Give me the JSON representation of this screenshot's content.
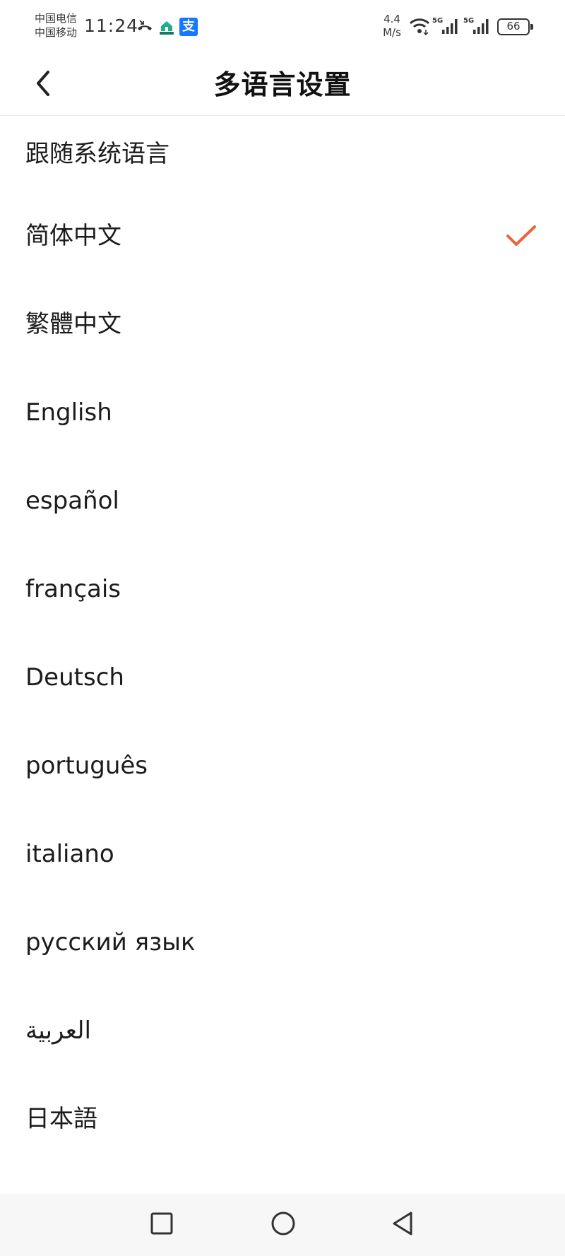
{
  "status_bar": {
    "carrier_1": "中国电信",
    "carrier_2": "中国移动",
    "time": "11:24",
    "net_speed_value": "4.4",
    "net_speed_unit": "M/s",
    "signal_1_label": "5G",
    "signal_2_label": "5G",
    "battery": "66",
    "alipay_glyph": "支"
  },
  "header": {
    "title": "多语言设置"
  },
  "languages": [
    {
      "label": "跟随系统语言",
      "selected": false
    },
    {
      "label": "简体中文",
      "selected": true
    },
    {
      "label": "繁體中文",
      "selected": false
    },
    {
      "label": "English",
      "selected": false
    },
    {
      "label": "español",
      "selected": false
    },
    {
      "label": "français",
      "selected": false
    },
    {
      "label": "Deutsch",
      "selected": false
    },
    {
      "label": "português",
      "selected": false
    },
    {
      "label": "italiano",
      "selected": false
    },
    {
      "label": "русский язык",
      "selected": false
    },
    {
      "label": "العربية",
      "selected": false
    },
    {
      "label": "日本語",
      "selected": false
    }
  ],
  "colors": {
    "accent_check": "#e8643c",
    "background": "#ffffff",
    "text": "#1c1c1c"
  },
  "icons": {
    "back": "chevron-left-icon",
    "selected": "check-icon",
    "nav_recent": "square-icon",
    "nav_home": "circle-icon",
    "nav_back": "triangle-left-icon"
  }
}
